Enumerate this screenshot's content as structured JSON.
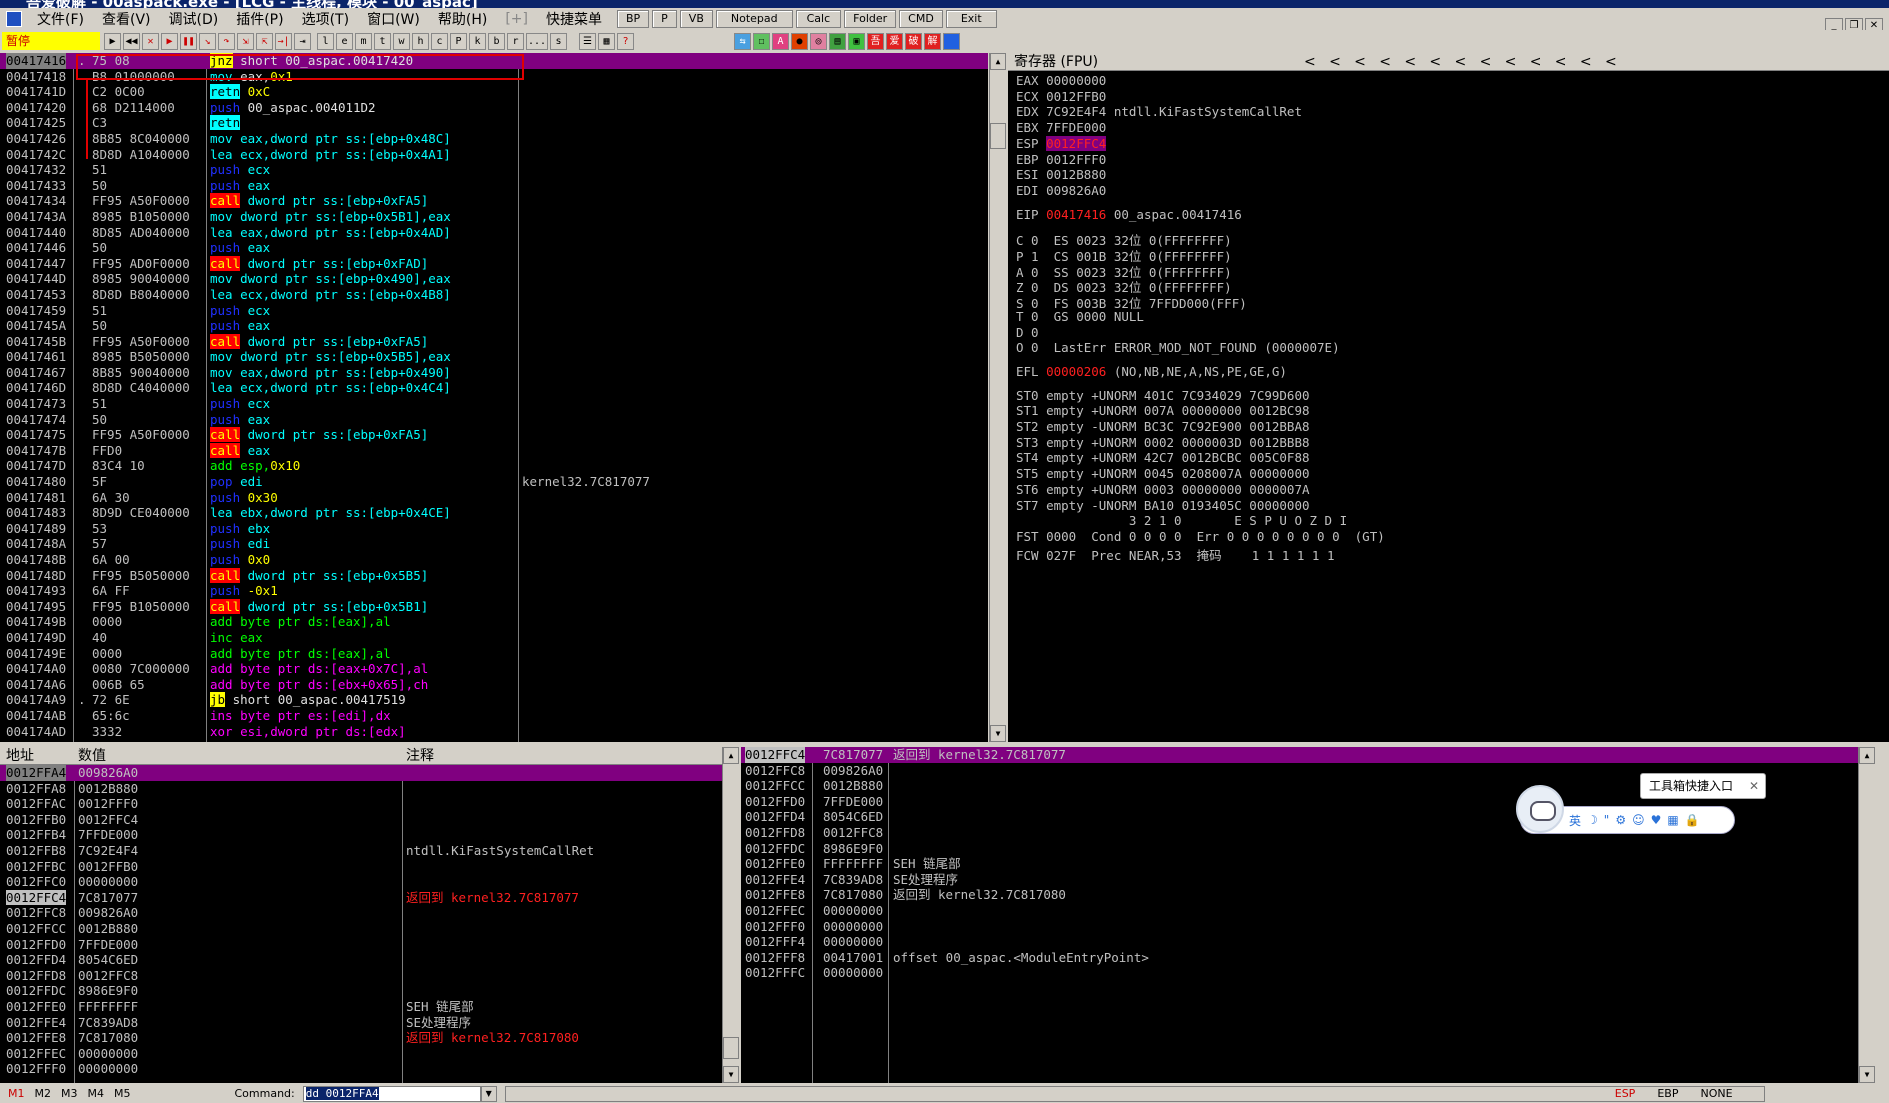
{
  "window": {
    "title": "吾爱破解 - 00aspack.exe - [LCG - 主线程, 模块 - 00_aspac]"
  },
  "menu": [
    {
      "label": "文件(F)"
    },
    {
      "label": "查看(V)"
    },
    {
      "label": "调试(D)"
    },
    {
      "label": "插件(P)"
    },
    {
      "label": "选项(T)"
    },
    {
      "label": "窗口(W)"
    },
    {
      "label": "帮助(H)"
    },
    {
      "label": "[+]"
    },
    {
      "label": "快捷菜单"
    }
  ],
  "quick_buttons": [
    {
      "label": "BP"
    },
    {
      "label": "P"
    },
    {
      "label": "VB"
    },
    {
      "label": "Notepad"
    },
    {
      "label": "Calc"
    },
    {
      "label": "Folder"
    },
    {
      "label": "CMD"
    },
    {
      "label": "Exit"
    }
  ],
  "toolbar": {
    "status": "暂停",
    "letters": [
      "l",
      "e",
      "m",
      "t",
      "w",
      "h",
      "c",
      "P",
      "k",
      "b",
      "r",
      "...",
      "s"
    ]
  },
  "disasm": [
    {
      "addr": "00417416",
      "hex": "75 08",
      "mark": ".",
      "ins": [
        {
          "t": "jnz",
          "c": "kw-jmp"
        },
        {
          "t": " short 00_aspac.00417420",
          "c": "txt-w"
        }
      ],
      "sel": true
    },
    {
      "addr": "00417418",
      "hex": "B8 01000000",
      "ins": [
        {
          "t": "mov",
          "c": "txt-b"
        },
        {
          "t": " eax,",
          "c": "txt-w"
        },
        {
          "t": "0x1",
          "c": "txt-y"
        }
      ]
    },
    {
      "addr": "0041741D",
      "hex": "C2 0C00",
      "ins": [
        {
          "t": "retn",
          "c": "kw-ret"
        },
        {
          "t": " 0xC",
          "c": "txt-y"
        }
      ]
    },
    {
      "addr": "00417420",
      "hex": "68 D2114000",
      "ins": [
        {
          "t": "push",
          "c": "kw-push"
        },
        {
          "t": " 00_aspac.004011D2",
          "c": "txt-w"
        }
      ]
    },
    {
      "addr": "00417425",
      "hex": "C3",
      "ins": [
        {
          "t": "retn",
          "c": "kw-ret"
        }
      ]
    },
    {
      "addr": "00417426",
      "hex": "8B85 8C040000",
      "ins": [
        {
          "t": "mov eax,dword ptr ss:[ebp+0x48C]",
          "c": "txt-b"
        }
      ]
    },
    {
      "addr": "0041742C",
      "hex": "8D8D A1040000",
      "ins": [
        {
          "t": "lea ecx,dword ptr ss:[ebp+0x4A1]",
          "c": "txt-b"
        }
      ]
    },
    {
      "addr": "00417432",
      "hex": "51",
      "ins": [
        {
          "t": "push",
          "c": "kw-push"
        },
        {
          "t": " ecx",
          "c": "txt-b"
        }
      ]
    },
    {
      "addr": "00417433",
      "hex": "50",
      "ins": [
        {
          "t": "push",
          "c": "kw-push"
        },
        {
          "t": " eax",
          "c": "txt-b"
        }
      ]
    },
    {
      "addr": "00417434",
      "hex": "FF95 A50F0000",
      "ins": [
        {
          "t": "call",
          "c": "kw-call"
        },
        {
          "t": " dword ptr ss:[ebp+0xFA5]",
          "c": "txt-b"
        }
      ]
    },
    {
      "addr": "0041743A",
      "hex": "8985 B1050000",
      "ins": [
        {
          "t": "mov dword ptr ss:[ebp+0x5B1],eax",
          "c": "txt-b"
        }
      ]
    },
    {
      "addr": "00417440",
      "hex": "8D85 AD040000",
      "ins": [
        {
          "t": "lea eax,dword ptr ss:[ebp+0x4AD]",
          "c": "txt-b"
        }
      ]
    },
    {
      "addr": "00417446",
      "hex": "50",
      "ins": [
        {
          "t": "push",
          "c": "kw-push"
        },
        {
          "t": " eax",
          "c": "txt-b"
        }
      ]
    },
    {
      "addr": "00417447",
      "hex": "FF95 AD0F0000",
      "ins": [
        {
          "t": "call",
          "c": "kw-call"
        },
        {
          "t": " dword ptr ss:[ebp+0xFAD]",
          "c": "txt-b"
        }
      ]
    },
    {
      "addr": "0041744D",
      "hex": "8985 90040000",
      "ins": [
        {
          "t": "mov dword ptr ss:[ebp+0x490],eax",
          "c": "txt-b"
        }
      ]
    },
    {
      "addr": "00417453",
      "hex": "8D8D B8040000",
      "ins": [
        {
          "t": "lea ecx,dword ptr ss:[ebp+0x4B8]",
          "c": "txt-b"
        }
      ]
    },
    {
      "addr": "00417459",
      "hex": "51",
      "ins": [
        {
          "t": "push",
          "c": "kw-push"
        },
        {
          "t": " ecx",
          "c": "txt-b"
        }
      ]
    },
    {
      "addr": "0041745A",
      "hex": "50",
      "ins": [
        {
          "t": "push",
          "c": "kw-push"
        },
        {
          "t": " eax",
          "c": "txt-b"
        }
      ]
    },
    {
      "addr": "0041745B",
      "hex": "FF95 A50F0000",
      "ins": [
        {
          "t": "call",
          "c": "kw-call"
        },
        {
          "t": " dword ptr ss:[ebp+0xFA5]",
          "c": "txt-b"
        }
      ]
    },
    {
      "addr": "00417461",
      "hex": "8985 B5050000",
      "ins": [
        {
          "t": "mov dword ptr ss:[ebp+0x5B5],eax",
          "c": "txt-b"
        }
      ]
    },
    {
      "addr": "00417467",
      "hex": "8B85 90040000",
      "ins": [
        {
          "t": "mov eax,dword ptr ss:[ebp+0x490]",
          "c": "txt-b"
        }
      ]
    },
    {
      "addr": "0041746D",
      "hex": "8D8D C4040000",
      "ins": [
        {
          "t": "lea ecx,dword ptr ss:[ebp+0x4C4]",
          "c": "txt-b"
        }
      ]
    },
    {
      "addr": "00417473",
      "hex": "51",
      "ins": [
        {
          "t": "push",
          "c": "kw-push"
        },
        {
          "t": " ecx",
          "c": "txt-b"
        }
      ]
    },
    {
      "addr": "00417474",
      "hex": "50",
      "ins": [
        {
          "t": "push",
          "c": "kw-push"
        },
        {
          "t": " eax",
          "c": "txt-b"
        }
      ]
    },
    {
      "addr": "00417475",
      "hex": "FF95 A50F0000",
      "ins": [
        {
          "t": "call",
          "c": "kw-call"
        },
        {
          "t": " dword ptr ss:[ebp+0xFA5]",
          "c": "txt-b"
        }
      ]
    },
    {
      "addr": "0041747B",
      "hex": "FFD0",
      "ins": [
        {
          "t": "call",
          "c": "kw-call"
        },
        {
          "t": " eax",
          "c": "txt-b"
        }
      ]
    },
    {
      "addr": "0041747D",
      "hex": "83C4 10",
      "ins": [
        {
          "t": "add esp,",
          "c": "txt-g"
        },
        {
          "t": "0x10",
          "c": "txt-y"
        }
      ]
    },
    {
      "addr": "00417480",
      "hex": "5F",
      "ins": [
        {
          "t": "pop",
          "c": "kw-push"
        },
        {
          "t": " edi",
          "c": "txt-b"
        }
      ],
      "comment": "kernel32.7C817077"
    },
    {
      "addr": "00417481",
      "hex": "6A 30",
      "ins": [
        {
          "t": "push",
          "c": "kw-push"
        },
        {
          "t": " 0x30",
          "c": "txt-y"
        }
      ]
    },
    {
      "addr": "00417483",
      "hex": "8D9D CE040000",
      "ins": [
        {
          "t": "lea ebx,dword ptr ss:[ebp+0x4CE]",
          "c": "txt-b"
        }
      ]
    },
    {
      "addr": "00417489",
      "hex": "53",
      "ins": [
        {
          "t": "push",
          "c": "kw-push"
        },
        {
          "t": " ebx",
          "c": "txt-b"
        }
      ]
    },
    {
      "addr": "0041748A",
      "hex": "57",
      "ins": [
        {
          "t": "push",
          "c": "kw-push"
        },
        {
          "t": " edi",
          "c": "txt-b"
        }
      ]
    },
    {
      "addr": "0041748B",
      "hex": "6A 00",
      "ins": [
        {
          "t": "push",
          "c": "kw-push"
        },
        {
          "t": " 0x0",
          "c": "txt-y"
        }
      ]
    },
    {
      "addr": "0041748D",
      "hex": "FF95 B5050000",
      "ins": [
        {
          "t": "call",
          "c": "kw-call"
        },
        {
          "t": " dword ptr ss:[ebp+0x5B5]",
          "c": "txt-b"
        }
      ]
    },
    {
      "addr": "00417493",
      "hex": "6A FF",
      "ins": [
        {
          "t": "push",
          "c": "kw-push"
        },
        {
          "t": " -0x1",
          "c": "txt-y"
        }
      ]
    },
    {
      "addr": "00417495",
      "hex": "FF95 B1050000",
      "ins": [
        {
          "t": "call",
          "c": "kw-call"
        },
        {
          "t": " dword ptr ss:[ebp+0x5B1]",
          "c": "txt-b"
        }
      ]
    },
    {
      "addr": "0041749B",
      "hex": "0000",
      "ins": [
        {
          "t": "add byte ptr ds:[eax],al",
          "c": "txt-g"
        }
      ]
    },
    {
      "addr": "0041749D",
      "hex": "40",
      "ins": [
        {
          "t": "inc eax",
          "c": "txt-g"
        }
      ]
    },
    {
      "addr": "0041749E",
      "hex": "0000",
      "ins": [
        {
          "t": "add byte ptr ds:[eax],al",
          "c": "txt-g"
        }
      ]
    },
    {
      "addr": "004174A0",
      "hex": "0080 7C000000",
      "ins": [
        {
          "t": "add byte ptr ds:[eax+0x7C],al",
          "c": "txt-m"
        }
      ]
    },
    {
      "addr": "004174A6",
      "hex": "006B 65",
      "ins": [
        {
          "t": "add byte ptr ds:[ebx+0x65],ch",
          "c": "txt-m"
        }
      ]
    },
    {
      "addr": "004174A9",
      "hex": "72 6E",
      "mark": ".",
      "ins": [
        {
          "t": "jb",
          "c": "kw-jmp"
        },
        {
          "t": " short 00_aspac.00417519",
          "c": "txt-w"
        }
      ]
    },
    {
      "addr": "004174AB",
      "hex": "65:6c",
      "ins": [
        {
          "t": "ins byte ptr es:[edi],dx",
          "c": "txt-m"
        }
      ]
    },
    {
      "addr": "004174AD",
      "hex": "3332",
      "ins": [
        {
          "t": "xor esi,dword ptr ds:[edx]",
          "c": "txt-m"
        }
      ]
    }
  ],
  "registers": {
    "header": "寄存器 (FPU)",
    "chevrons": "<   <   <   <   <   <   <   <   <   <   <   <   <",
    "lines": [
      {
        "t": "EAX 00000000"
      },
      {
        "t": "ECX 0012FFB0"
      },
      {
        "t": "EDX 7C92E4F4 ntdll.KiFastSystemCallRet"
      },
      {
        "t": "EBX 7FFDE000"
      },
      {
        "t": "ESP ",
        "hl": "0012FFC4"
      },
      {
        "t": "EBP 0012FFF0"
      },
      {
        "t": "ESI 0012B880"
      },
      {
        "t": "EDI 009826A0"
      }
    ],
    "eip_label": "EIP",
    "eip_value": "00417416",
    "eip_rest": " 00_aspac.00417416",
    "flags": [
      "C 0  ES 0023 32位 0(FFFFFFFF)",
      "P 1  CS 001B 32位 0(FFFFFFFF)",
      "A 0  SS 0023 32位 0(FFFFFFFF)",
      "Z 0  DS 0023 32位 0(FFFFFFFF)",
      "S 0  FS 003B 32位 7FFDD000(FFF)",
      "T 0  GS 0000 NULL",
      "D 0",
      "O 0  LastErr ERROR_MOD_NOT_FOUND (0000007E)"
    ],
    "efl_label": "EFL",
    "efl_value": "00000206",
    "efl_rest": " (NO,NB,NE,A,NS,PE,GE,G)",
    "fpu": [
      "ST0 empty +UNORM 401C 7C934029 7C99D600",
      "ST1 empty +UNORM 007A 00000000 0012BC98",
      "ST2 empty -UNORM BC3C 7C92E900 0012BBA8",
      "ST3 empty +UNORM 0002 0000003D 0012BBB8",
      "ST4 empty +UNORM 42C7 0012BCBC 005C0F88",
      "ST5 empty +UNORM 0045 0208007A 00000000",
      "ST6 empty +UNORM 0003 00000000 0000007A",
      "ST7 empty -UNORM BA10 0193405C 00000000",
      "               3 2 1 0       E S P U O Z D I",
      "FST 0000  Cond 0 0 0 0  Err 0 0 0 0 0 0 0 0  (GT)",
      "FCW 027F  Prec NEAR,53  掩码    1 1 1 1 1 1"
    ]
  },
  "dump": {
    "headers": [
      "地址",
      "数值",
      "注释"
    ],
    "rows": [
      {
        "a": "0012FFA4",
        "v": "009826A0",
        "c": "",
        "sel": true
      },
      {
        "a": "0012FFA8",
        "v": "0012B880",
        "c": ""
      },
      {
        "a": "0012FFAC",
        "v": "0012FFF0",
        "c": ""
      },
      {
        "a": "0012FFB0",
        "v": "0012FFC4",
        "c": ""
      },
      {
        "a": "0012FFB4",
        "v": "7FFDE000",
        "c": ""
      },
      {
        "a": "0012FFB8",
        "v": "7C92E4F4",
        "c": "ntdll.KiFastSystemCallRet"
      },
      {
        "a": "0012FFBC",
        "v": "0012FFB0",
        "c": ""
      },
      {
        "a": "0012FFC0",
        "v": "00000000",
        "c": ""
      },
      {
        "a": "0012FFC4",
        "v": "7C817077",
        "c": "返回到 kernel32.7C817077",
        "red": true,
        "hl": true
      },
      {
        "a": "0012FFC8",
        "v": "009826A0",
        "c": ""
      },
      {
        "a": "0012FFCC",
        "v": "0012B880",
        "c": ""
      },
      {
        "a": "0012FFD0",
        "v": "7FFDE000",
        "c": ""
      },
      {
        "a": "0012FFD4",
        "v": "8054C6ED",
        "c": ""
      },
      {
        "a": "0012FFD8",
        "v": "0012FFC8",
        "c": ""
      },
      {
        "a": "0012FFDC",
        "v": "8986E9F0",
        "c": ""
      },
      {
        "a": "0012FFE0",
        "v": "FFFFFFFF",
        "c": "SEH 链尾部"
      },
      {
        "a": "0012FFE4",
        "v": "7C839AD8",
        "c": "SE处理程序"
      },
      {
        "a": "0012FFE8",
        "v": "7C817080",
        "c": "返回到 kernel32.7C817080",
        "red": true
      },
      {
        "a": "0012FFEC",
        "v": "00000000",
        "c": ""
      },
      {
        "a": "0012FFF0",
        "v": "00000000",
        "c": ""
      }
    ]
  },
  "stack": {
    "rows": [
      {
        "a": "0012FFC4",
        "v": "7C817077",
        "c": "返回到 kernel32.7C817077",
        "sel": true
      },
      {
        "a": "0012FFC8",
        "v": "009826A0",
        "c": ""
      },
      {
        "a": "0012FFCC",
        "v": "0012B880",
        "c": ""
      },
      {
        "a": "0012FFD0",
        "v": "7FFDE000",
        "c": ""
      },
      {
        "a": "0012FFD4",
        "v": "8054C6ED",
        "c": ""
      },
      {
        "a": "0012FFD8",
        "v": "0012FFC8",
        "c": ""
      },
      {
        "a": "0012FFDC",
        "v": "8986E9F0",
        "c": ""
      },
      {
        "a": "0012FFE0",
        "v": "FFFFFFFF",
        "c": "SEH 链尾部"
      },
      {
        "a": "0012FFE4",
        "v": "7C839AD8",
        "c": "SE处理程序"
      },
      {
        "a": "0012FFE8",
        "v": "7C817080",
        "c": "返回到 kernel32.7C817080"
      },
      {
        "a": "0012FFEC",
        "v": "00000000",
        "c": ""
      },
      {
        "a": "0012FFF0",
        "v": "00000000",
        "c": ""
      },
      {
        "a": "0012FFF4",
        "v": "00000000",
        "c": ""
      },
      {
        "a": "0012FFF8",
        "v": "00417001",
        "c": "offset 00_aspac.<ModuleEntryPoint>"
      },
      {
        "a": "0012FFFC",
        "v": "00000000",
        "c": ""
      }
    ]
  },
  "tool_popup": {
    "label": "工具箱快捷入口",
    "close": "✕"
  },
  "tool_bar_items": [
    "英",
    "☽",
    "\"",
    "⚙",
    "☺",
    "♥",
    "▦",
    "🔒"
  ],
  "statusbar": {
    "m_labels": [
      "M1",
      "M2",
      "M3",
      "M4",
      "M5"
    ],
    "command_label": "Command:",
    "command_value": "dd 0012FFA4",
    "right": [
      "ESP",
      "EBP",
      "NONE"
    ]
  },
  "colors": {
    "selection": "#800080",
    "call_bg": "#ff0000",
    "jmp_bg": "#ffff00",
    "push": "#2030ff",
    "annotation": "#e00000"
  }
}
